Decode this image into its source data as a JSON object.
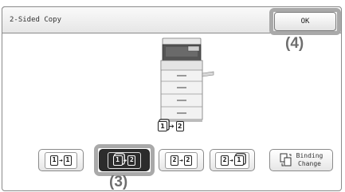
{
  "dialog": {
    "title": "2-Sided Copy",
    "ok_label": "OK"
  },
  "callouts": {
    "ok": "(4)",
    "mode": "(3)"
  },
  "preview": {
    "current_mode": {
      "from": "1",
      "to": "2",
      "from_duplex": true,
      "to_duplex": false
    }
  },
  "modes": [
    {
      "from": "1",
      "to": "1",
      "selected": false
    },
    {
      "from": "1",
      "to": "2",
      "selected": true
    },
    {
      "from": "2",
      "to": "2",
      "selected": false
    },
    {
      "from": "2",
      "to": "1",
      "selected": false
    }
  ],
  "binding": {
    "label": "Binding\nChange",
    "icon": "binding-change-icon"
  },
  "icons": {
    "copier": "copier-icon",
    "page": "page-icon",
    "arrow": "arrow-right-icon"
  }
}
